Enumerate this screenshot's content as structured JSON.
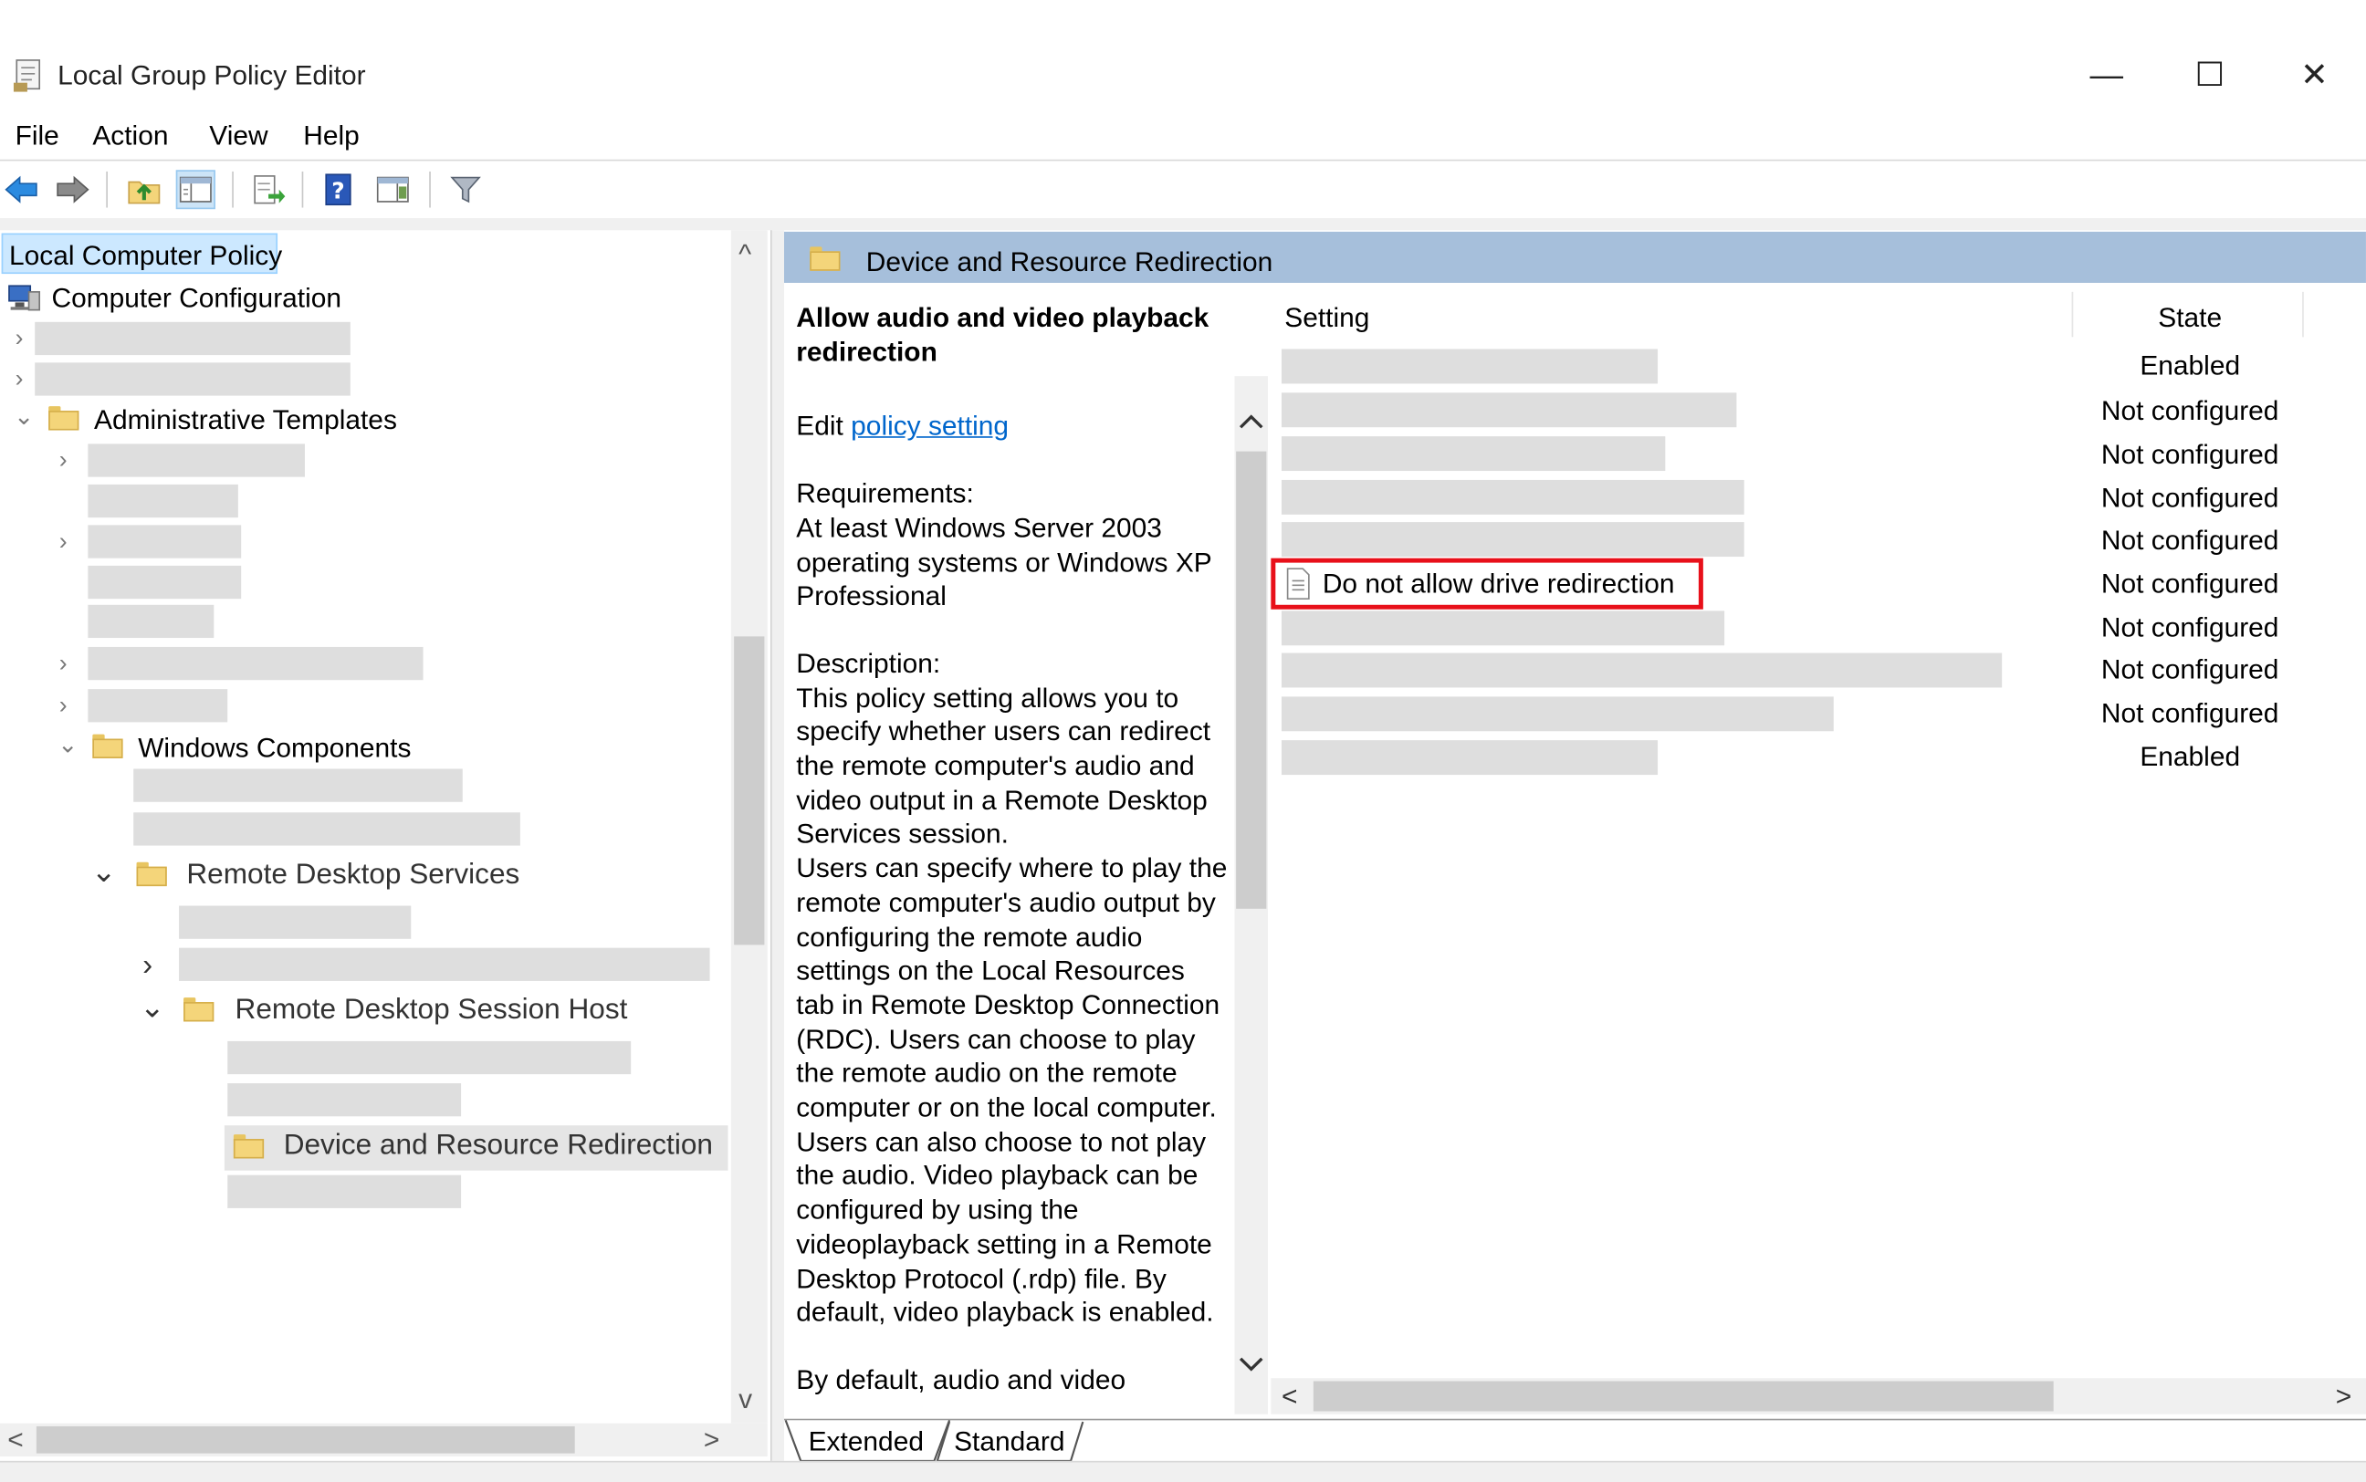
{
  "window": {
    "title": "Local Group Policy Editor",
    "controls": {
      "minimize": "—",
      "maximize": "☐",
      "close": "✕"
    }
  },
  "menu": [
    "File",
    "Action",
    "View",
    "Help"
  ],
  "toolbar": {
    "icons": [
      "back-arrow-icon",
      "forward-arrow-icon",
      "up-folder-icon",
      "show-hide-tree-icon",
      "export-list-icon",
      "help-icon",
      "show-hide-action-pane-icon",
      "filter-icon"
    ]
  },
  "tree": {
    "root": "Local Computer Policy",
    "computer_configuration": "Computer Configuration",
    "administrative_templates": "Administrative Templates",
    "windows_components": "Windows Components",
    "remote_desktop_services": "Remote Desktop Services",
    "remote_desktop_session_host": "Remote Desktop Session Host",
    "device_and_resource_redirection": "Device and Resource Redirection",
    "chevrons": {
      "collapsed": "›",
      "expanded": "⌄"
    }
  },
  "right_pane": {
    "header_title": "Device and Resource Redirection",
    "description": {
      "heading": "Allow audio and video playback redirection",
      "edit_prefix": "Edit",
      "edit_link": "policy setting",
      "requirements_label": "Requirements:",
      "requirements_text": "At least Windows Server 2003 operating systems or Windows XP Professional",
      "description_label": "Description:",
      "description_text": "This policy setting allows you to specify whether users can redirect the remote computer's audio and video output in a Remote Desktop Services session.",
      "description_text_2": "Users can specify where to play the remote computer's audio output by configuring the remote audio settings on the Local Resources tab in Remote Desktop Connection (RDC). Users can choose to play the remote audio on the remote computer or on the local computer. Users can also choose to not play the audio. Video playback can be configured by using the videoplayback setting in a Remote Desktop Protocol (.rdp) file. By default, video playback is enabled.",
      "description_text_3": "By default, audio and video"
    },
    "columns": {
      "setting": "Setting",
      "state": "State"
    },
    "highlighted_setting": "Do not allow drive redirection",
    "states": [
      "Enabled",
      "Not configured",
      "Not configured",
      "Not configured",
      "Not configured",
      "Not configured",
      "Not configured",
      "Not configured",
      "Not configured",
      "Enabled"
    ],
    "tabs": [
      "Extended",
      "Standard"
    ],
    "highlight_color": "#e8101a"
  },
  "scroll_glyphs": {
    "up": "^",
    "down": "v",
    "left": "<",
    "right": ">"
  }
}
